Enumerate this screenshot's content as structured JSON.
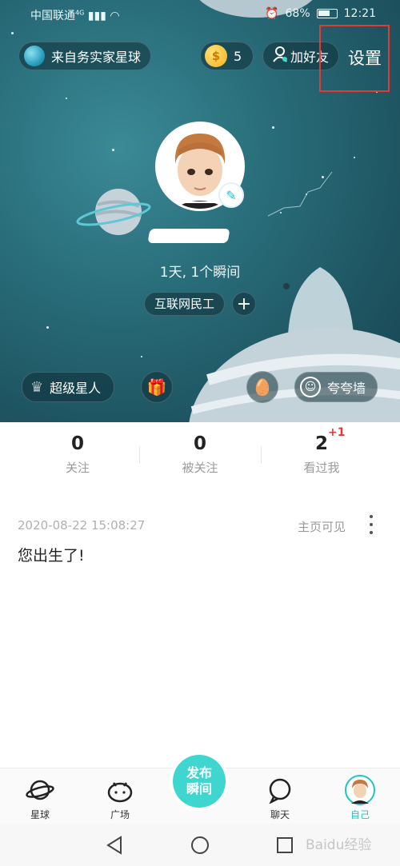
{
  "status_bar": {
    "carrier": "中国联通",
    "network": "4G",
    "battery": "68%",
    "time": "12:21"
  },
  "header": {
    "planet_button": "来自务实家星球",
    "coins": "5",
    "add_friend": "加好友",
    "settings": "设置"
  },
  "profile": {
    "stats_line": "1天, 1个瞬间",
    "tag": "互联网民工",
    "tag_add": "+",
    "super_star": "超级星人",
    "praise_wall": "夸夸墙"
  },
  "counts": [
    {
      "value": "0",
      "label": "关注"
    },
    {
      "value": "0",
      "label": "被关注"
    },
    {
      "value": "2",
      "label": "看过我",
      "badge": "+1"
    }
  ],
  "post": {
    "date": "2020-08-22 15:08:27",
    "visibility": "主页可见",
    "text": "您出生了!"
  },
  "tabbar": {
    "tabs": [
      "星球",
      "广场",
      "聊天",
      "自己"
    ],
    "publish_line1": "发布",
    "publish_line2": "瞬间",
    "active_color": "#20c4c4"
  },
  "watermark": "Baidu经验",
  "colors": {
    "accent": "#3fd6d0",
    "highlight_box": "#e53935",
    "hero_bg": "#2a6f7c"
  }
}
